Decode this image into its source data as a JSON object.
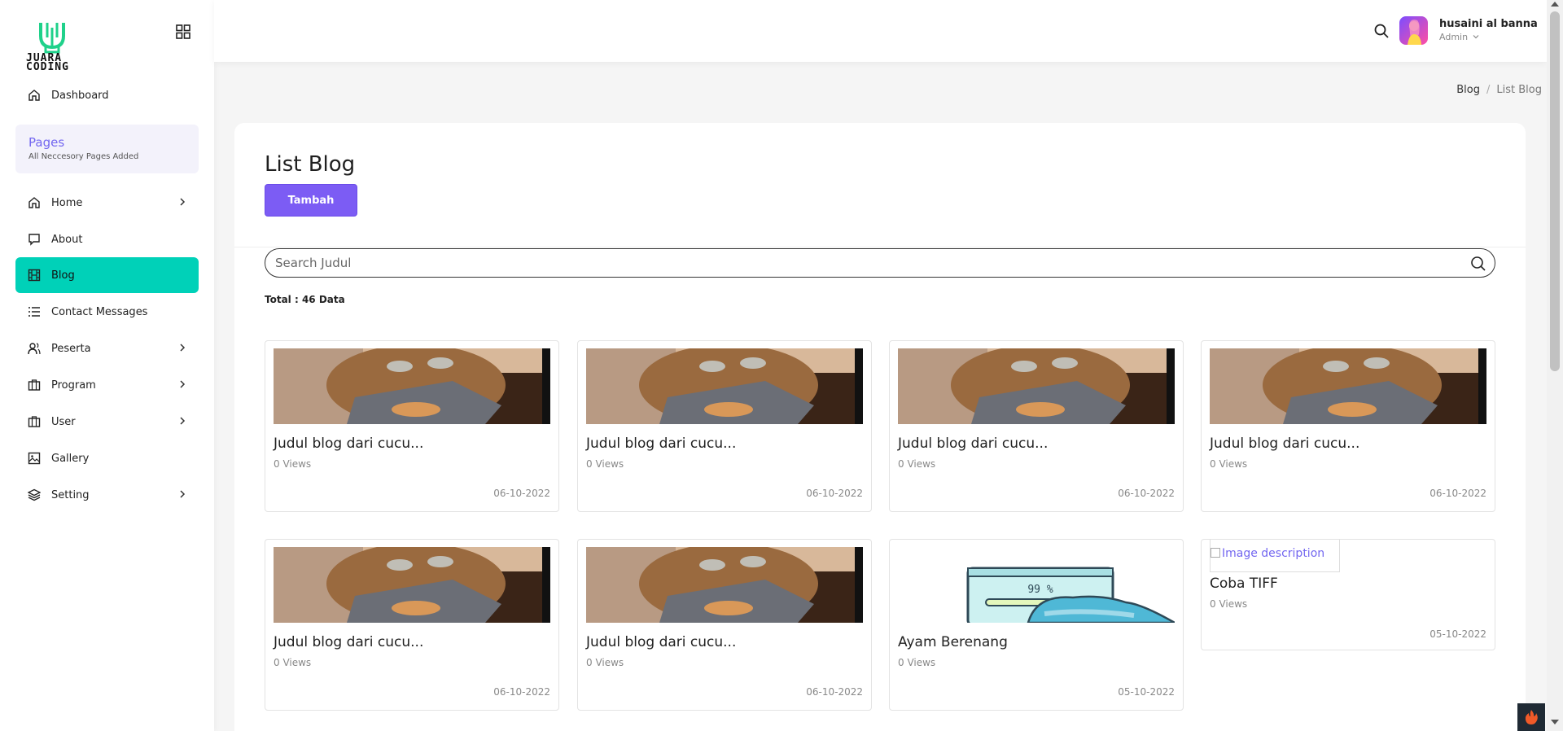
{
  "brand": {
    "logo_text_line1": "JUARA",
    "logo_text_line2": "CODING",
    "accent": "#00d1b8",
    "primary": "#7c5cf4"
  },
  "sidebar": {
    "dashboard": "Dashboard",
    "pages_title": "Pages",
    "pages_sub": "All Neccesory Pages Added",
    "items": [
      {
        "label": "Home",
        "icon": "home-icon",
        "has_children": true
      },
      {
        "label": "About",
        "icon": "chat-icon",
        "has_children": false
      },
      {
        "label": "Blog",
        "icon": "film-icon",
        "has_children": false,
        "active": true
      },
      {
        "label": "Contact Messages",
        "icon": "list-icon",
        "has_children": false
      },
      {
        "label": "Peserta",
        "icon": "users-icon",
        "has_children": true
      },
      {
        "label": "Program",
        "icon": "briefcase-icon",
        "has_children": true
      },
      {
        "label": "User",
        "icon": "briefcase-icon",
        "has_children": true
      },
      {
        "label": "Gallery",
        "icon": "image-icon",
        "has_children": false
      },
      {
        "label": "Setting",
        "icon": "layers-icon",
        "has_children": true
      }
    ]
  },
  "topbar": {
    "user_name": "husaini al banna",
    "user_role": "Admin"
  },
  "breadcrumb": {
    "parent": "Blog",
    "sep": "/",
    "current": "List Blog"
  },
  "main": {
    "title": "List Blog",
    "add_button": "Tambah",
    "search_placeholder": "Search Judul",
    "total_label": "Total : 46 Data"
  },
  "blogs": [
    {
      "title": "Judul blog dari cucu...",
      "views": "0 Views",
      "date": "06-10-2022",
      "thumb": "cat"
    },
    {
      "title": "Judul blog dari cucu...",
      "views": "0 Views",
      "date": "06-10-2022",
      "thumb": "cat"
    },
    {
      "title": "Judul blog dari cucu...",
      "views": "0 Views",
      "date": "06-10-2022",
      "thumb": "cat"
    },
    {
      "title": "Judul blog dari cucu...",
      "views": "0 Views",
      "date": "06-10-2022",
      "thumb": "cat"
    },
    {
      "title": "Judul blog dari cucu...",
      "views": "0 Views",
      "date": "06-10-2022",
      "thumb": "cat"
    },
    {
      "title": "Judul blog dari cucu...",
      "views": "0 Views",
      "date": "06-10-2022",
      "thumb": "cat"
    },
    {
      "title": "Ayam Berenang",
      "views": "0 Views",
      "date": "05-10-2022",
      "thumb": "illustration",
      "thumb_text": "99 %"
    },
    {
      "title": "Coba TIFF",
      "views": "0 Views",
      "date": "05-10-2022",
      "thumb": "broken",
      "alt": "Image description"
    }
  ]
}
